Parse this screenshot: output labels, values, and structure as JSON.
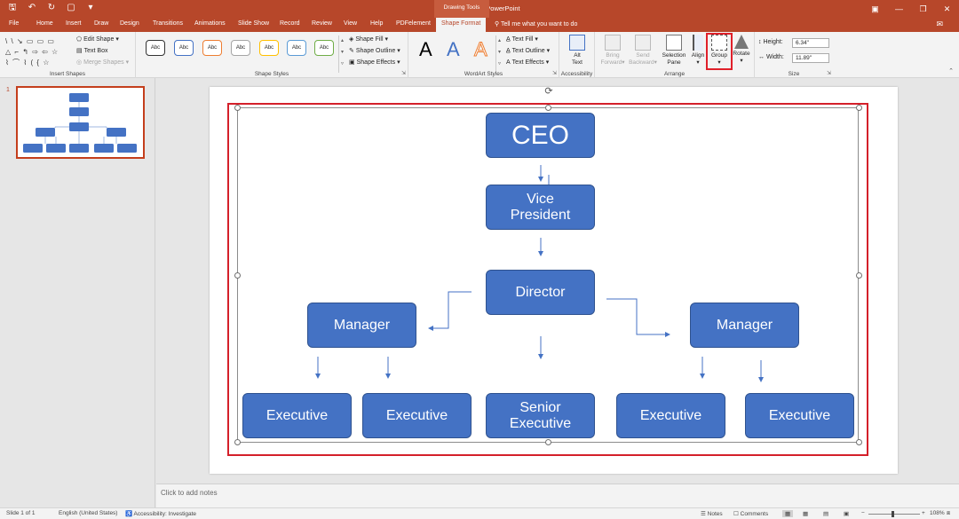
{
  "window": {
    "title": "Presentation3 - PowerPoint",
    "context_tab_group": "Drawing Tools"
  },
  "tabs": [
    "File",
    "Home",
    "Insert",
    "Draw",
    "Design",
    "Transitions",
    "Animations",
    "Slide Show",
    "Record",
    "Review",
    "View",
    "Help",
    "PDFelement",
    "Shape Format"
  ],
  "active_tab": "Shape Format",
  "tell_me": "Tell me what you want to do",
  "ribbon": {
    "insert_shapes": {
      "label": "Insert Shapes",
      "edit_shape": "Edit Shape",
      "text_box": "Text Box",
      "merge_shapes": "Merge Shapes"
    },
    "shape_styles": {
      "label": "Shape Styles",
      "preset": "Abc",
      "shape_fill": "Shape Fill",
      "shape_outline": "Shape Outline",
      "shape_effects": "Shape Effects"
    },
    "wordart": {
      "label": "WordArt Styles",
      "letter": "A",
      "text_fill": "Text Fill",
      "text_outline": "Text Outline",
      "text_effects": "Text Effects"
    },
    "accessibility": {
      "label": "Accessibility",
      "alt_text_1": "Alt",
      "alt_text_2": "Text"
    },
    "arrange": {
      "label": "Arrange",
      "bring_forward_1": "Bring",
      "bring_forward_2": "Forward",
      "send_backward_1": "Send",
      "send_backward_2": "Backward",
      "selection_pane_1": "Selection",
      "selection_pane_2": "Pane",
      "align": "Align",
      "group": "Group",
      "rotate": "Rotate"
    },
    "size": {
      "label": "Size",
      "height_label": "Height:",
      "height_value": "6.34\"",
      "width_label": "Width:",
      "width_value": "11.89\""
    }
  },
  "thumbnail": {
    "number": "1"
  },
  "org_chart": {
    "ceo": "CEO",
    "vp_line1": "Vice",
    "vp_line2": "President",
    "director": "Director",
    "manager_left": "Manager",
    "manager_right": "Manager",
    "exec_1": "Executive",
    "exec_2": "Executive",
    "senior_line1": "Senior",
    "senior_line2": "Executive",
    "exec_4": "Executive",
    "exec_5": "Executive"
  },
  "notes": {
    "placeholder": "Click to add notes"
  },
  "status": {
    "slide": "Slide 1 of 1",
    "language": "English (United States)",
    "accessibility": "Accessibility: Investigate",
    "notes": "Notes",
    "comments": "Comments",
    "zoom": "108%"
  },
  "colors": {
    "brand": "#b7472a",
    "shape_fill": "#4472c4",
    "highlight": "#e0202a"
  }
}
